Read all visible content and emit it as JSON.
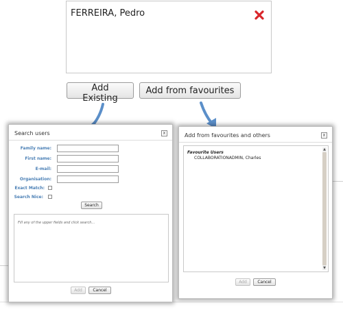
{
  "selected_users": [
    {
      "name": "FERREIRA, Pedro"
    }
  ],
  "buttons": {
    "add_existing": "Add Existing",
    "add_favourites": "Add from favourites"
  },
  "search_dialog": {
    "title": "Search users",
    "close": "x",
    "fields": {
      "family_name": "Family name:",
      "first_name": "First name:",
      "email": "E-mail:",
      "organisation": "Organisation:",
      "exact_match": "Exact Match:",
      "search_nice": "Search Nice:"
    },
    "search_button": "Search",
    "hint": "Fill any of the upper fields and click search...",
    "add_button": "Add",
    "cancel_button": "Cancel"
  },
  "favourites_dialog": {
    "title": "Add from favourites and others",
    "close": "x",
    "section_heading": "Favourite Users",
    "users": [
      "COLLABORATIONADMIN, Charles"
    ],
    "add_button": "Add",
    "cancel_button": "Cancel"
  },
  "colors": {
    "remove_icon": "#d9262b",
    "arrow": "#5b8fc9",
    "label": "#4a7fb5"
  },
  "icons": {
    "remove": "remove-x-icon",
    "arrow": "arrow-down-icon"
  }
}
